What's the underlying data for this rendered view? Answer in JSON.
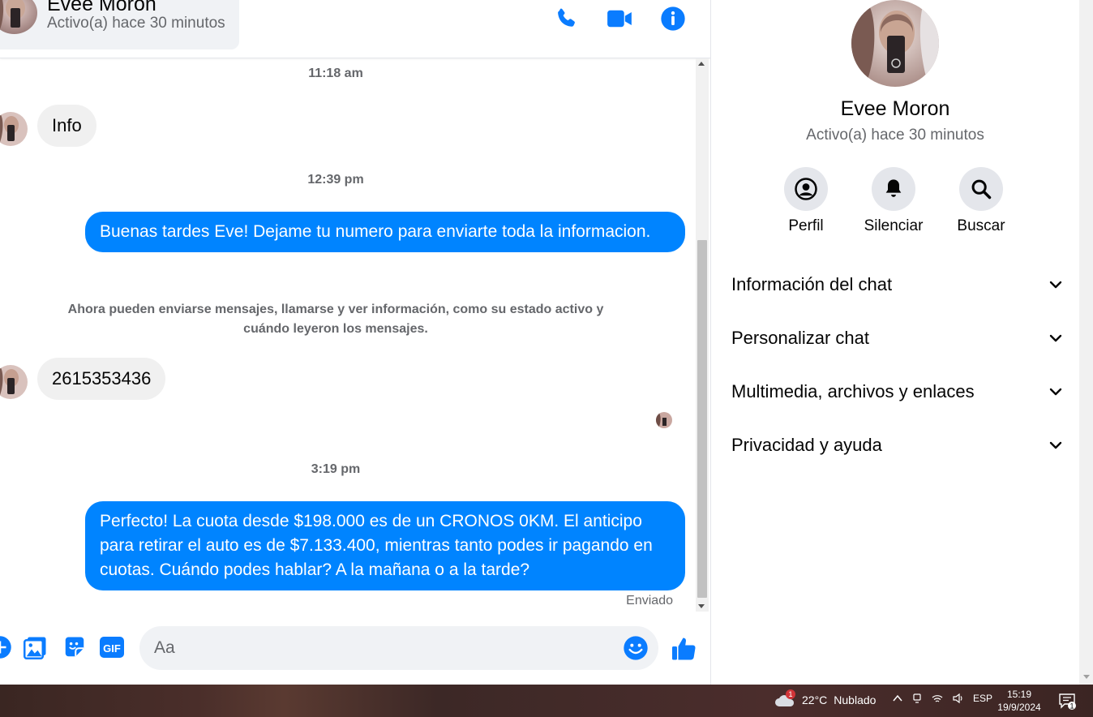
{
  "contact": {
    "name": "Evee Moron",
    "status": "Activo(a) hace 30 minutos"
  },
  "header": {
    "icons": [
      "phone-icon",
      "video-call-icon",
      "info-icon"
    ]
  },
  "messages": {
    "ts1": "11:18 am",
    "in1": "Info",
    "ts2": "12:39 pm",
    "out1": "Buenas tardes Eve! Dejame tu numero para enviarte toda la informacion.",
    "system_note": "Ahora pueden enviarse mensajes, llamarse y ver información, como su estado activo y cuándo leyeron los mensajes.",
    "in2": "2615353436",
    "ts3": "3:19 pm",
    "out2": "Perfecto! La cuota desde $198.000 es de un CRONOS 0KM. El anticipo para retirar el auto es de $7.133.400, mientras tanto podes ir pagando en cuotas. Cuándo podes hablar? A la mañana o a la tarde?",
    "sent_status": "Enviado"
  },
  "composer": {
    "placeholder": "Aa",
    "gif_label": "GIF"
  },
  "panel": {
    "actions": [
      {
        "label": "Perfil",
        "icon": "profile-icon"
      },
      {
        "label": "Silenciar",
        "icon": "bell-icon"
      },
      {
        "label": "Buscar",
        "icon": "search-icon"
      }
    ],
    "sections": [
      {
        "label": "Información del chat"
      },
      {
        "label": "Personalizar chat"
      },
      {
        "label": "Multimedia, archivos y enlaces"
      },
      {
        "label": "Privacidad y ayuda"
      }
    ]
  },
  "taskbar": {
    "weather_temp": "22°C",
    "weather_desc": "Nublado",
    "weather_badge": "1",
    "language": "ESP",
    "time": "15:19",
    "date": "19/9/2024",
    "notification_count": "1"
  },
  "colors": {
    "accent": "#0084ff",
    "bubble_incoming": "#f0f0f0",
    "icon_blue": "#0a7cff"
  }
}
